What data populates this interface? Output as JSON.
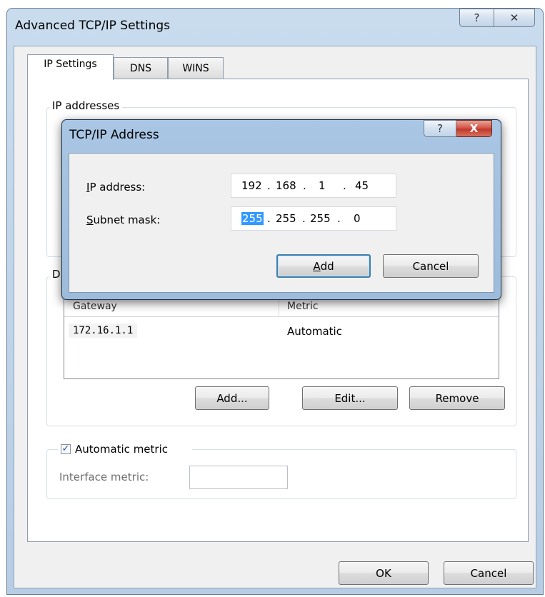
{
  "outer_dialog": {
    "title": "Advanced TCP/IP Settings",
    "help_button": "?",
    "close_button": "✕",
    "tabs": [
      {
        "label": "IP Settings",
        "active": true
      },
      {
        "label": "DNS",
        "active": false
      },
      {
        "label": "WINS",
        "active": false
      }
    ],
    "ip_addresses_group": {
      "label": "IP addresses"
    },
    "gateways_group": {
      "label_fragment": "D",
      "columns": [
        "Gateway",
        "Metric"
      ],
      "rows": [
        {
          "gateway": "172.16.1.1",
          "metric": "Automatic"
        }
      ],
      "buttons": {
        "add": "Add...",
        "edit": "Edit...",
        "remove": "Remove"
      }
    },
    "metric_group": {
      "automatic_metric_label": "Automatic metric",
      "automatic_metric_checked": true,
      "interface_metric_label": "Interface metric:",
      "interface_metric_value": ""
    },
    "ok_button": "OK",
    "cancel_button": "Cancel"
  },
  "inner_dialog": {
    "title": "TCP/IP Address",
    "help_button": "?",
    "close_button": "X",
    "ip_address": {
      "label_first": "I",
      "label_rest": "P address:",
      "octets": [
        "192",
        "168",
        "1",
        "45"
      ]
    },
    "subnet_mask": {
      "label_first": "S",
      "label_rest": "ubnet mask:",
      "octets": [
        "255",
        "255",
        "255",
        "0"
      ],
      "selected_octet": "255"
    },
    "dot": ".",
    "add_button_first": "A",
    "add_button_rest": "dd",
    "cancel_button": "Cancel"
  },
  "colors": {
    "title_bar": "#b7cde4",
    "inner_title_bar": "#9dbbdb",
    "selection": "#3399ff",
    "close_button_red": "#c0392b"
  }
}
